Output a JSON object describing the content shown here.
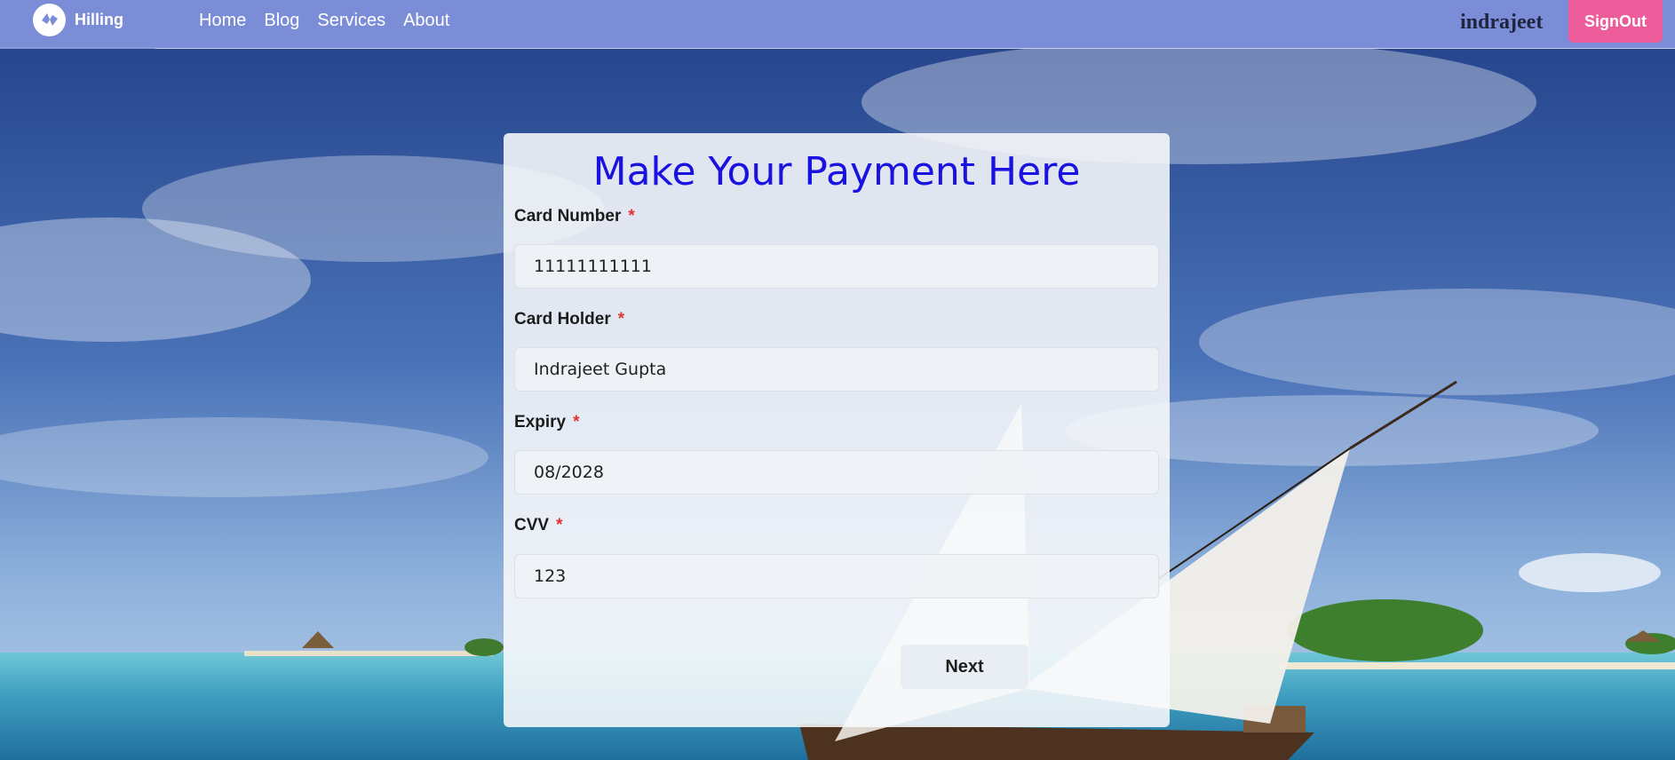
{
  "app": {
    "name": "Hilling"
  },
  "nav": {
    "links": [
      {
        "label": "Home"
      },
      {
        "label": "Blog"
      },
      {
        "label": "Services"
      },
      {
        "label": "About"
      }
    ],
    "username": "indrajeet",
    "signout_label": "SignOut"
  },
  "form": {
    "title": "Make Your Payment Here",
    "required_marker": "*",
    "card_number": {
      "label": "Card Number",
      "value": "11111111111"
    },
    "card_holder": {
      "label": "Card Holder",
      "value": "Indrajeet Gupta"
    },
    "expiry": {
      "label": "Expiry",
      "value": "08/2028"
    },
    "cvv": {
      "label": "CVV",
      "value": "123"
    },
    "next_label": "Next"
  },
  "colors": {
    "navbar": "#7b8dd6",
    "signout": "#ee5d9b",
    "title": "#1a12e0",
    "required": "#e23333"
  }
}
